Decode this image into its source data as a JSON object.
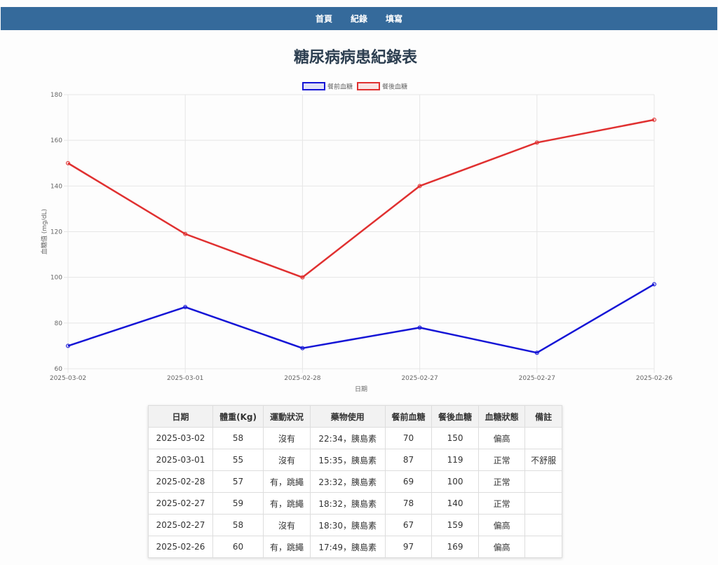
{
  "nav": {
    "items": [
      {
        "label": "首頁"
      },
      {
        "label": "紀錄"
      },
      {
        "label": "填寫"
      }
    ]
  },
  "page": {
    "title": "糖尿病病患紀錄表"
  },
  "colors": {
    "nav_bg": "#356a9b",
    "before_meal": "#1515d6",
    "after_meal": "#e03030"
  },
  "chart_data": {
    "type": "line",
    "categories": [
      "2025-03-02",
      "2025-03-01",
      "2025-02-28",
      "2025-02-27",
      "2025-02-27",
      "2025-02-26"
    ],
    "series": [
      {
        "name": "餐前血糖",
        "values": [
          70,
          87,
          69,
          78,
          67,
          97
        ]
      },
      {
        "name": "餐後血糖",
        "values": [
          150,
          119,
          100,
          140,
          159,
          169
        ]
      }
    ],
    "title": "",
    "xlabel": "日期",
    "ylabel": "血糖值 (mg/dL)",
    "ylim": [
      60,
      180
    ],
    "yticks": [
      60,
      80,
      100,
      120,
      140,
      160,
      180
    ],
    "grid": true,
    "legend": "top-center"
  },
  "table": {
    "headers": [
      "日期",
      "體重(Kg)",
      "運動狀況",
      "藥物使用",
      "餐前血糖",
      "餐後血糖",
      "血糖狀態",
      "備註"
    ],
    "rows": [
      [
        "2025-03-02",
        "58",
        "沒有",
        "22:34，胰島素",
        "70",
        "150",
        "偏高",
        ""
      ],
      [
        "2025-03-01",
        "55",
        "沒有",
        "15:35，胰島素",
        "87",
        "119",
        "正常",
        "不舒服"
      ],
      [
        "2025-02-28",
        "57",
        "有，跳繩",
        "23:32，胰島素",
        "69",
        "100",
        "正常",
        ""
      ],
      [
        "2025-02-27",
        "59",
        "有，跳繩",
        "18:32，胰島素",
        "78",
        "140",
        "正常",
        ""
      ],
      [
        "2025-02-27",
        "58",
        "沒有",
        "18:30，胰島素",
        "67",
        "159",
        "偏高",
        ""
      ],
      [
        "2025-02-26",
        "60",
        "有，跳繩",
        "17:49，胰島素",
        "97",
        "169",
        "偏高",
        ""
      ]
    ]
  }
}
